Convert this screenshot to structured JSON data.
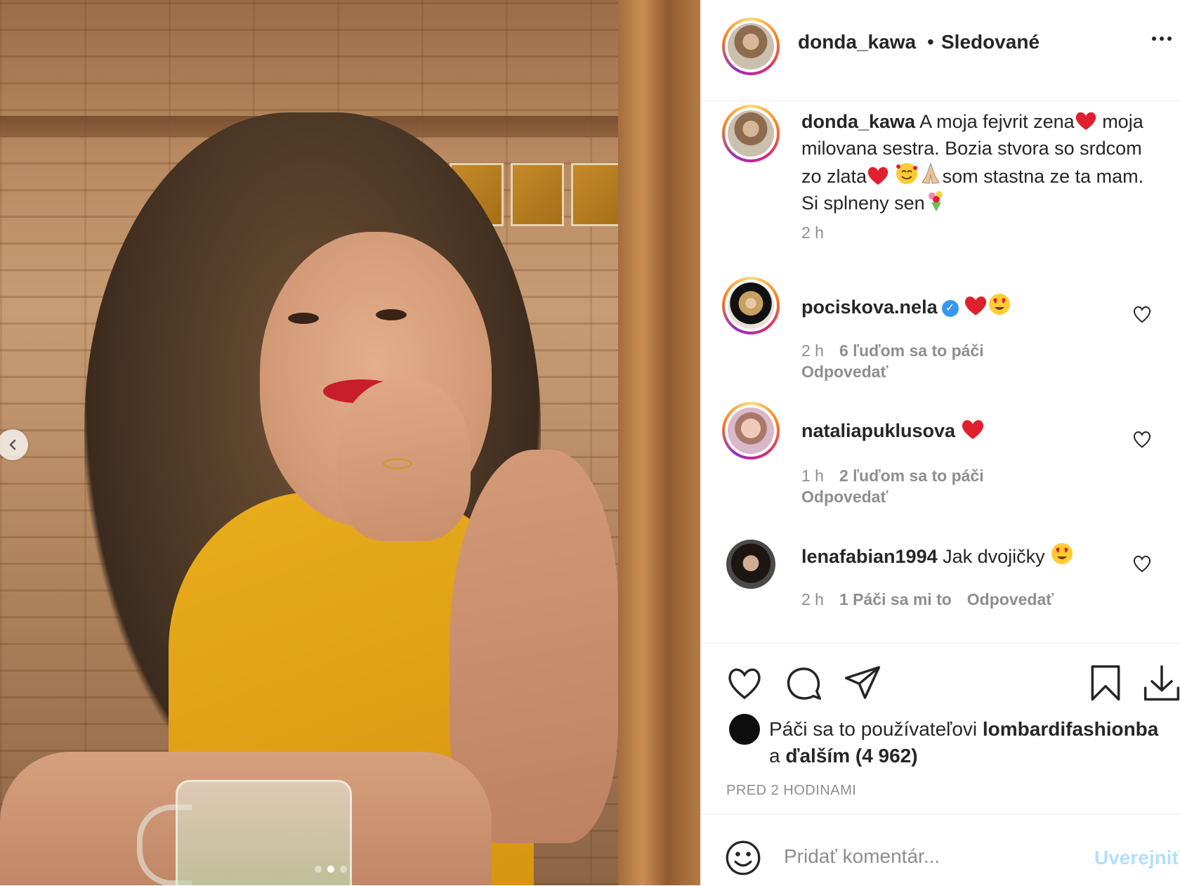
{
  "post": {
    "author": "donda_kawa",
    "separator": "•",
    "follow_status": "Sledované",
    "carousel_dots": 3,
    "active_dot": 2
  },
  "caption": {
    "username": "donda_kawa",
    "text_1": " A moja fejvrit zena",
    "text_2": " moja milovana sestra. Bozia stvora so srdcom zo zlata",
    "text_3": "som stastna ze ta mam. Si splneny sen",
    "time": "2 h"
  },
  "comments": [
    {
      "username": "pociskova.nela",
      "verified": true,
      "text": "",
      "time": "2 h",
      "likes": "6 ľuďom sa to páči",
      "reply": "Odpovedať"
    },
    {
      "username": "nataliapuklusova",
      "verified": false,
      "text": "",
      "time": "1 h",
      "likes": "2 ľuďom sa to páči",
      "reply": "Odpovedať"
    },
    {
      "username": "lenafabian1994",
      "verified": false,
      "text": " Jak dvojičky ",
      "time": "2 h",
      "likes": "1 Páči sa mi to",
      "reply": "Odpovedať"
    }
  ],
  "likes": {
    "prefix": "Páči sa to používateľovi ",
    "user": "lombardifashionba",
    "suffix_1": " a ",
    "suffix_2": "ďalším (4 962)"
  },
  "posted_ago": "PRED 2 HODINAMI",
  "composer": {
    "placeholder": "Pridať komentár...",
    "post_label": "Uverejniť"
  },
  "colors": {
    "accent": "#0095f6",
    "post_disabled": "#b2dffc",
    "heart_red": "#ed4956",
    "verified": "#3897f0"
  }
}
